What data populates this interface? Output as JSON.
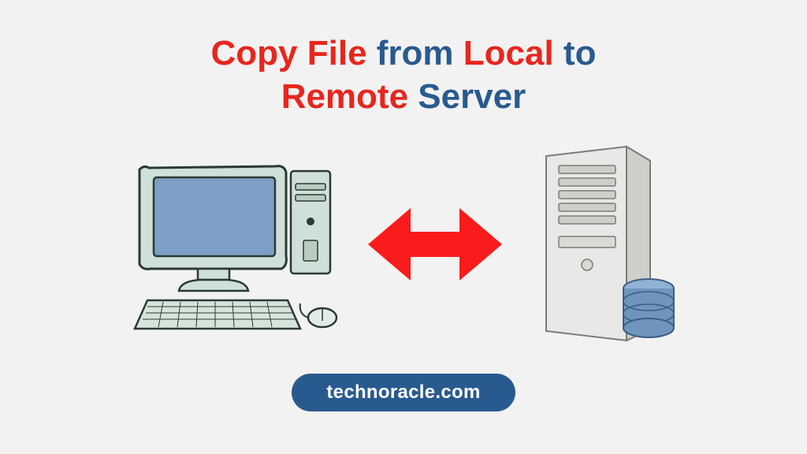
{
  "title": {
    "copy_file": "Copy File",
    "from": " from ",
    "local": "Local",
    "to": " to ",
    "remote": "Remote",
    "server": " Server"
  },
  "badge": {
    "text": "technoracle.com"
  },
  "colors": {
    "red": "#e8261d",
    "blue": "#295a8f",
    "arrow": "#fa1c1c",
    "bg": "#f2f2f2"
  }
}
